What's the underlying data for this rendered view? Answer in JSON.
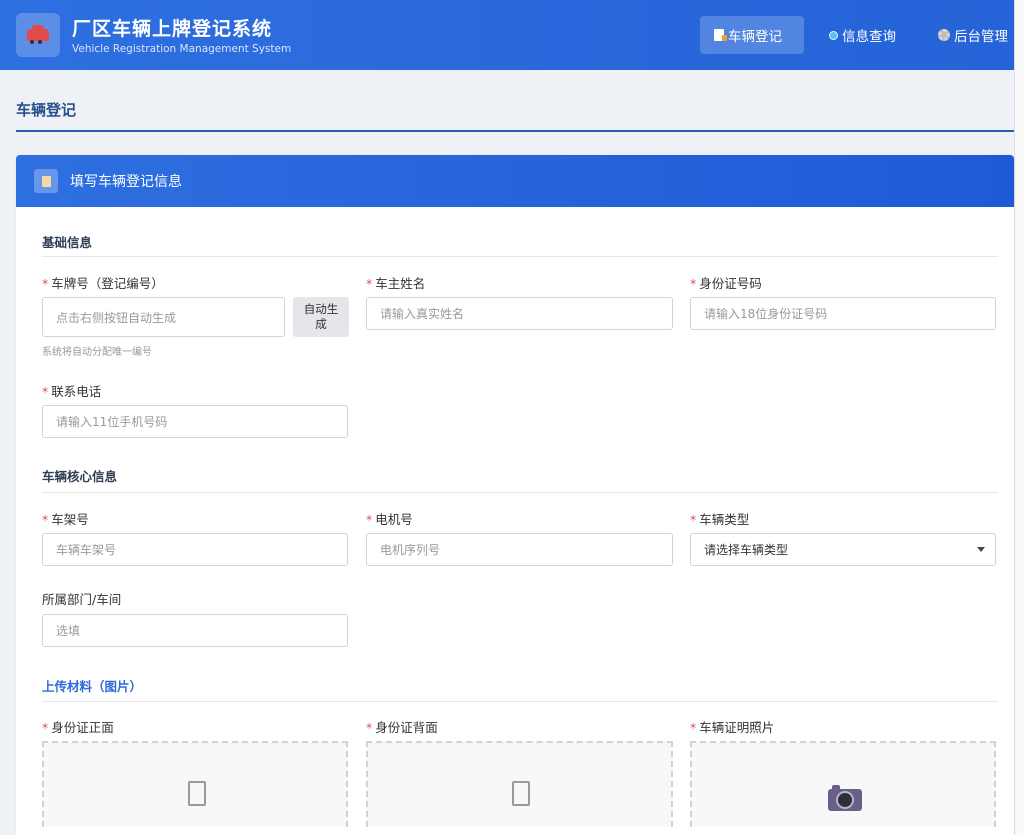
{
  "header": {
    "title_cn": "厂区车辆上牌登记系统",
    "title_en": "Vehicle Registration Management System",
    "logo_icon": "car-icon",
    "nav": [
      {
        "label": "车辆登记",
        "icon": "document-icon",
        "active": true
      },
      {
        "label": "信息查询",
        "icon": "globe-icon",
        "active": false
      },
      {
        "label": "后台管理",
        "icon": "gear-icon",
        "active": false
      }
    ]
  },
  "page": {
    "breadcrumb": "车辆登记"
  },
  "card": {
    "title": "填写车辆登记信息"
  },
  "sections": {
    "basic": {
      "title": "基础信息",
      "plate": {
        "label": "车牌号（登记编号）",
        "placeholder": "点击右侧按钮自动生成",
        "help": "系统将自动分配唯一编号",
        "button": "自动生成"
      },
      "owner": {
        "label": "车主姓名",
        "placeholder": "请输入真实姓名"
      },
      "id_number": {
        "label": "身份证号码",
        "placeholder": "请输入18位身份证号码"
      },
      "phone": {
        "label": "联系电话",
        "placeholder": "请输入11位手机号码"
      }
    },
    "core": {
      "title": "车辆核心信息",
      "frame": {
        "label": "车架号",
        "placeholder": "车辆车架号"
      },
      "motor": {
        "label": "电机号",
        "placeholder": "电机序列号"
      },
      "type": {
        "label": "车辆类型",
        "value": "请选择车辆类型"
      },
      "dept": {
        "label": "所属部门/车间",
        "placeholder": "选填"
      }
    },
    "upload": {
      "title": "上传材料（图片）",
      "id_front": {
        "label": "身份证正面"
      },
      "id_back": {
        "label": "身份证背面"
      },
      "vehicle_proof": {
        "label": "车辆证明照片"
      }
    }
  },
  "required_mark": "*",
  "colors": {
    "header_bg": "#2e6fe0",
    "accent": "#2f6bd8",
    "required": "#e45050"
  }
}
